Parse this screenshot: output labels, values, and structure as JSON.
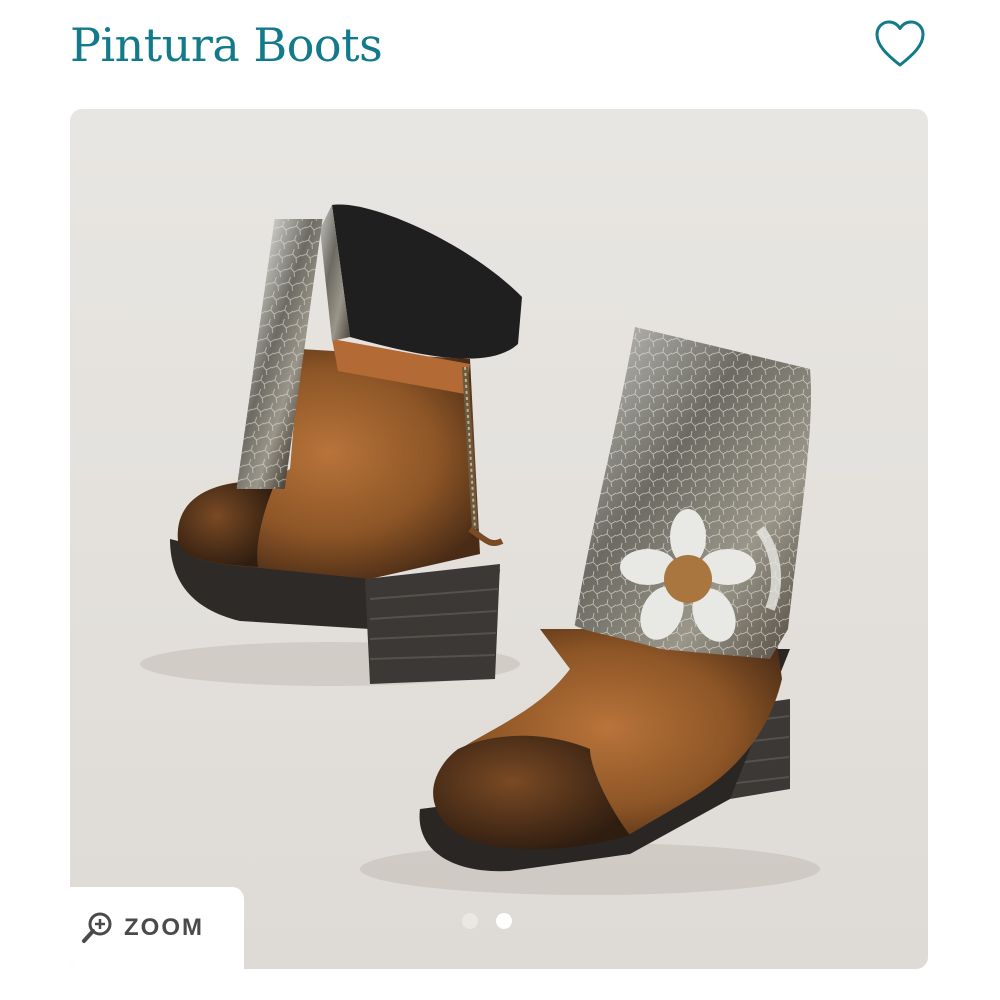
{
  "product": {
    "title": "Pintura Boots",
    "favorite_icon": "heart-outline-icon",
    "accent_color": "#127a8a"
  },
  "gallery": {
    "image_description": "product-photo-boots",
    "zoom": {
      "label": "ZOOM",
      "icon": "magnifier-plus-icon"
    },
    "pager": {
      "count": 2,
      "active_index": 1
    }
  }
}
